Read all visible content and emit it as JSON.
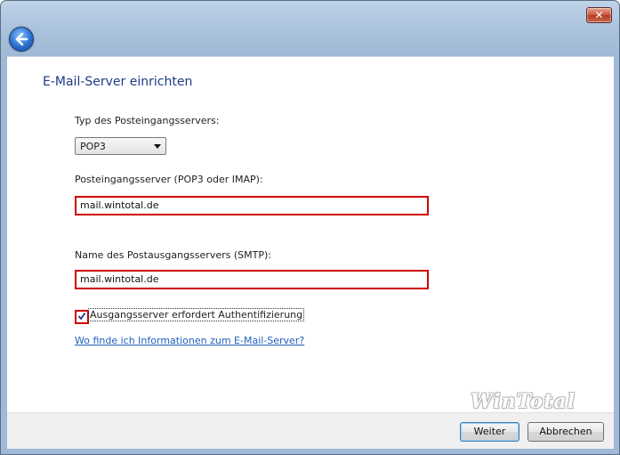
{
  "window": {
    "close_symbol": "✕"
  },
  "nav": {
    "back_icon": "back-arrow-icon"
  },
  "page": {
    "title": "E-Mail-Server einrichten",
    "incoming_type_label": "Typ des Posteingangsservers:",
    "incoming_type_value": "POP3",
    "incoming_server_label": "Posteingangsserver (POP3 oder IMAP):",
    "incoming_server_value": "mail.wintotal.de",
    "outgoing_server_label": "Name des Postausgangsservers (SMTP):",
    "outgoing_server_value": "mail.wintotal.de",
    "auth_label": "Ausgangsserver erfordert Authentifizierung",
    "auth_checked": true,
    "help_link": "Wo finde ich Informationen zum E-Mail-Server?",
    "watermark": "WinTotal"
  },
  "footer": {
    "next_label": "Weiter",
    "cancel_label": "Abbrechen"
  },
  "colors": {
    "highlight": "#d00000",
    "title_text": "#1e3a8a",
    "link": "#1f5fbf"
  }
}
